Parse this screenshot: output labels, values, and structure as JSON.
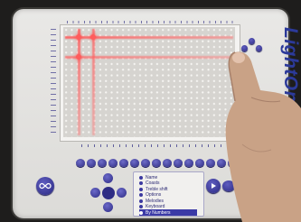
{
  "device": {
    "brand_name": "LightOne",
    "screen": {
      "lit_rows": 2,
      "lit_columns": 2
    },
    "menu": {
      "items": [
        {
          "label": "Name"
        },
        {
          "label": "Coasts"
        },
        {
          "label": "Treble shift"
        },
        {
          "label": "Options"
        },
        {
          "label": "Melodies"
        },
        {
          "label": "Keyboard"
        },
        {
          "label": "By Numbers"
        }
      ],
      "selected_index": 6
    },
    "colors": {
      "body": "#e3e2df",
      "buttons": "#2e2c84",
      "laser": "#ff5c5c",
      "brand": "#2c3a9a"
    },
    "icons": {
      "left_round_button": "infinity-icon",
      "right_round_button": "play-icon"
    }
  }
}
